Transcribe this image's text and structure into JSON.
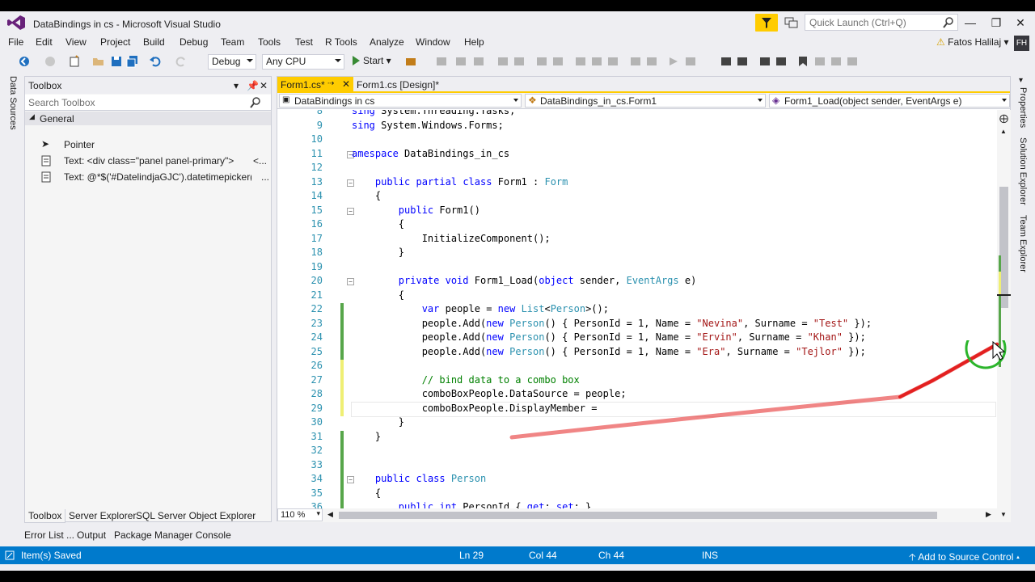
{
  "window": {
    "title": "DataBindings in cs - Microsoft Visual Studio",
    "quick_launch_placeholder": "Quick Launch (Ctrl+Q)",
    "user": "Fatos Halilaj",
    "avatar": "FH"
  },
  "menu": [
    "File",
    "Edit",
    "View",
    "Project",
    "Build",
    "Debug",
    "Team",
    "Tools",
    "Test",
    "R Tools",
    "Analyze",
    "Window",
    "Help"
  ],
  "toolbar": {
    "config": "Debug",
    "platform": "Any CPU",
    "start_label": "Start"
  },
  "left_tabs": [
    "Data Sources"
  ],
  "right_tabs": [
    "Properties",
    "Solution Explorer",
    "Team Explorer"
  ],
  "toolbox": {
    "title": "Toolbox",
    "search_placeholder": "Search Toolbox",
    "group": "General",
    "items": [
      {
        "label": "Pointer",
        "ext": ""
      },
      {
        "label": "Text: <div class=\"panel panel-primary\">",
        "ext": "<..."
      },
      {
        "label": "Text:    @*$('#DatelindjaGJC').datetimepicker(",
        "ext": "..."
      }
    ]
  },
  "panel_tabs": [
    "Toolbox",
    "Server Explorer",
    "SQL Server Object Explorer"
  ],
  "bottom_tabs": [
    "Error List ...",
    "Output",
    "Package Manager Console"
  ],
  "editor": {
    "tabs": [
      {
        "label": "Form1.cs*",
        "active": true
      },
      {
        "label": "Form1.cs [Design]*",
        "active": false
      }
    ],
    "nav": [
      "DataBindings in cs",
      "DataBindings_in_cs.Form1",
      "Form1_Load(object sender, EventArgs e)"
    ],
    "zoom": "110 %",
    "lines": [
      {
        "n": "8",
        "code": "sing System.Threading.Tasks;",
        "change": ""
      },
      {
        "n": "9",
        "code": "sing System.Windows.Forms;",
        "change": ""
      },
      {
        "n": "10",
        "code": "",
        "change": ""
      },
      {
        "n": "11",
        "code": "amespace DataBindings_in_cs",
        "change": ""
      },
      {
        "n": "12",
        "code": "",
        "change": ""
      },
      {
        "n": "13",
        "code": "    public partial class Form1 : Form",
        "change": ""
      },
      {
        "n": "14",
        "code": "    {",
        "change": ""
      },
      {
        "n": "15",
        "code": "        public Form1()",
        "change": ""
      },
      {
        "n": "16",
        "code": "        {",
        "change": ""
      },
      {
        "n": "17",
        "code": "            InitializeComponent();",
        "change": ""
      },
      {
        "n": "18",
        "code": "        }",
        "change": ""
      },
      {
        "n": "19",
        "code": "",
        "change": ""
      },
      {
        "n": "20",
        "code": "        private void Form1_Load(object sender, EventArgs e)",
        "change": ""
      },
      {
        "n": "21",
        "code": "        {",
        "change": ""
      },
      {
        "n": "22",
        "code": "            var people = new List<Person>();",
        "change": "saved"
      },
      {
        "n": "23",
        "code": "            people.Add(new Person() { PersonId = 1, Name = \"Nevina\", Surname = \"Test\" });",
        "change": "saved"
      },
      {
        "n": "24",
        "code": "            people.Add(new Person() { PersonId = 1, Name = \"Ervin\", Surname = \"Khan\" });",
        "change": "saved"
      },
      {
        "n": "25",
        "code": "            people.Add(new Person() { PersonId = 1, Name = \"Era\", Surname = \"Tejlor\" });",
        "change": "saved"
      },
      {
        "n": "26",
        "code": "",
        "change": "unsaved"
      },
      {
        "n": "27",
        "code": "            // bind data to a combo box",
        "change": "unsaved"
      },
      {
        "n": "28",
        "code": "            comboBoxPeople.DataSource = people;",
        "change": "unsaved"
      },
      {
        "n": "29",
        "code": "            comboBoxPeople.DisplayMember = ",
        "change": "unsaved"
      },
      {
        "n": "30",
        "code": "        }",
        "change": ""
      },
      {
        "n": "31",
        "code": "    }",
        "change": "saved"
      },
      {
        "n": "32",
        "code": "",
        "change": "saved"
      },
      {
        "n": "33",
        "code": "",
        "change": "saved"
      },
      {
        "n": "34",
        "code": "    public class Person",
        "change": "saved"
      },
      {
        "n": "35",
        "code": "    {",
        "change": "saved"
      },
      {
        "n": "36",
        "code": "        public int PersonId { get; set; }",
        "change": "saved"
      }
    ]
  },
  "status": {
    "message": "Item(s) Saved",
    "ln": "Ln 29",
    "col": "Col 44",
    "ch": "Ch 44",
    "mode": "INS",
    "source_control": "Add to Source Control"
  },
  "colors": {
    "accent": "#007acc",
    "tab_active": "#ffcc00",
    "saved_change": "#57a64a",
    "unsaved_change": "#efef74"
  }
}
